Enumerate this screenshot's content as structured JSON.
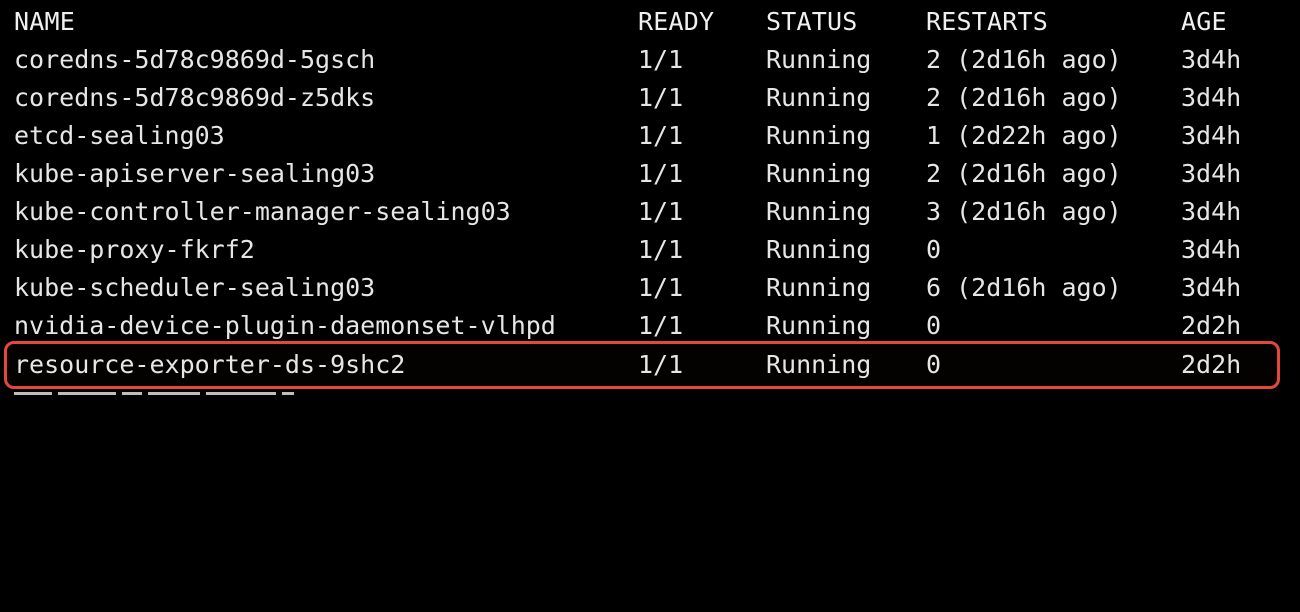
{
  "table": {
    "headers": {
      "name": "NAME",
      "ready": "READY",
      "status": "STATUS",
      "restarts": "RESTARTS",
      "age": "AGE"
    },
    "rows": [
      {
        "name": "coredns-5d78c9869d-5gsch",
        "ready": "1/1",
        "status": "Running",
        "restarts": "2 (2d16h ago)",
        "age": "3d4h"
      },
      {
        "name": "coredns-5d78c9869d-z5dks",
        "ready": "1/1",
        "status": "Running",
        "restarts": "2 (2d16h ago)",
        "age": "3d4h"
      },
      {
        "name": "etcd-sealing03",
        "ready": "1/1",
        "status": "Running",
        "restarts": "1 (2d22h ago)",
        "age": "3d4h"
      },
      {
        "name": "kube-apiserver-sealing03",
        "ready": "1/1",
        "status": "Running",
        "restarts": "2 (2d16h ago)",
        "age": "3d4h"
      },
      {
        "name": "kube-controller-manager-sealing03",
        "ready": "1/1",
        "status": "Running",
        "restarts": "3 (2d16h ago)",
        "age": "3d4h"
      },
      {
        "name": "kube-proxy-fkrf2",
        "ready": "1/1",
        "status": "Running",
        "restarts": "0",
        "age": "3d4h"
      },
      {
        "name": "kube-scheduler-sealing03",
        "ready": "1/1",
        "status": "Running",
        "restarts": "6 (2d16h ago)",
        "age": "3d4h"
      },
      {
        "name": "nvidia-device-plugin-daemonset-vlhpd",
        "ready": "1/1",
        "status": "Running",
        "restarts": "0",
        "age": "2d2h"
      },
      {
        "name": "resource-exporter-ds-9shc2",
        "ready": "1/1",
        "status": "Running",
        "restarts": "0",
        "age": "2d2h"
      }
    ],
    "highlighted_row_index": 8
  },
  "colors": {
    "background": "#000000",
    "text": "#e6e6e6",
    "highlight_border": "#e5483a"
  }
}
